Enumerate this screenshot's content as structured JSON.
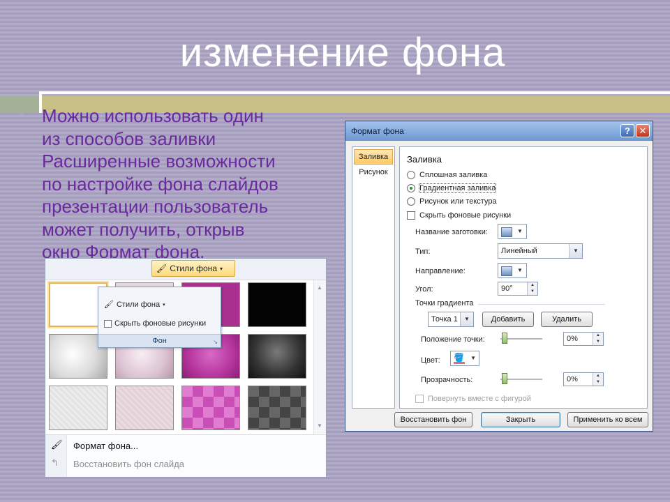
{
  "slide": {
    "title": "изменение фона",
    "body_lines": [
      "Можно использовать один",
      "из способов заливки",
      "Расширенные возможности",
      "по настройке фона слайдов",
      "презентации пользователь",
      "может получить, открыв",
      "окно Формат фона."
    ]
  },
  "gallery": {
    "styles_button": "Стили фона",
    "menu": {
      "styles_item": "Стили фона",
      "hide_graphics": "Скрыть фоновые рисунки",
      "group_label": "Фон"
    },
    "tiles": [
      {
        "name": "tile-white-plain",
        "color": "#ffffff"
      },
      {
        "name": "tile-pale-pink",
        "color": "#eadde2"
      },
      {
        "name": "tile-magenta",
        "color": "#b1379e"
      },
      {
        "name": "tile-black",
        "color": "#050505"
      },
      {
        "name": "tile-white-radial",
        "color": "#f5f5f5"
      },
      {
        "name": "tile-pink-radial",
        "color": "#e2c8d8"
      },
      {
        "name": "tile-magenta-radial",
        "color": "#c248b0"
      },
      {
        "name": "tile-dark-radial",
        "color": "#3a3a3a"
      },
      {
        "name": "tile-light-texture",
        "color": "#e9e9e9"
      },
      {
        "name": "tile-pink-texture",
        "color": "#e7d6dc"
      },
      {
        "name": "tile-magenta-diamond",
        "color": "#d765c4"
      },
      {
        "name": "tile-dark-diamond",
        "color": "#555555"
      }
    ],
    "format_background": "Формат фона...",
    "reset_background": "Восстановить фон слайда"
  },
  "dialog": {
    "title": "Формат фона",
    "nav": [
      "Заливка",
      "Рисунок"
    ],
    "section": "Заливка",
    "options": {
      "solid": "Сплошная заливка",
      "gradient": "Градиентная заливка",
      "picture": "Рисунок или текстура",
      "hide": "Скрыть фоновые рисунки"
    },
    "preset_label": "Название заготовки:",
    "type_label": "Тип:",
    "type_value": "Линейный",
    "direction_label": "Направление:",
    "angle_label": "Угол:",
    "angle_value": "90°",
    "stops_label": "Точки градиента",
    "stop_value": "Точка 1",
    "add_button": "Добавить",
    "remove_button": "Удалить",
    "position_label": "Положение точки:",
    "position_value": "0%",
    "color_label": "Цвет:",
    "transparency_label": "Прозрачность:",
    "transparency_value": "0%",
    "rotate_label": "Повернуть вместе с фигурой",
    "reset_button": "Восстановить фон",
    "close_button": "Закрыть",
    "apply_all_button": "Применить ко всем"
  },
  "colors": {
    "body_text": "#6a2a9e",
    "accent_bar": "#c8c087",
    "slide_bg": "#a8a1c0"
  }
}
